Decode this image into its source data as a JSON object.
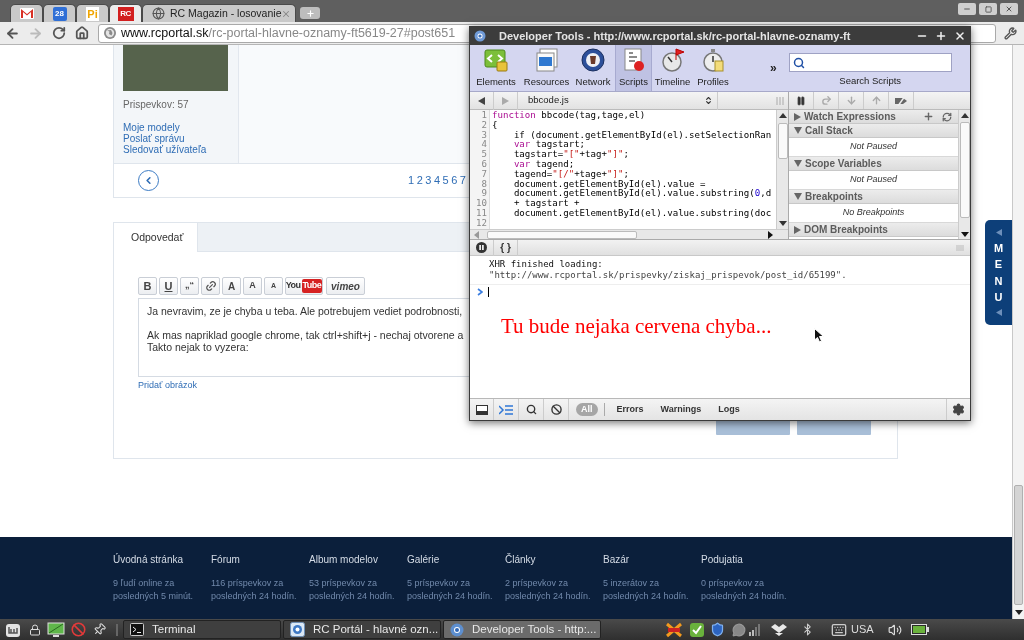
{
  "browser": {
    "tabs": [
      {
        "kind": "mail",
        "selected": false
      },
      {
        "kind": "calendar",
        "icon_text": "28",
        "selected": false
      },
      {
        "kind": "letters",
        "icon_text": "Pi",
        "selected": false
      },
      {
        "kind": "site",
        "icon_text": "RC",
        "selected": true
      },
      {
        "kind": "page",
        "title": "RC Magazin - losovanie",
        "selected": false
      }
    ],
    "url_host": "www.rcportal.sk",
    "url_path": "/rc-portal-hlavne-oznamy-ft5619-27#post651"
  },
  "post": {
    "posts_count": "Prispevkov: 57",
    "links": [
      "Moje modely",
      "Poslať správu",
      "Sledovať užívateľa"
    ],
    "pages": [
      "1",
      "2",
      "3",
      "4",
      "5",
      "6",
      "7"
    ]
  },
  "reply": {
    "tabs": [
      {
        "label": "Odpovedať",
        "selected": true
      }
    ],
    "toolbar": [
      {
        "kind": "bold",
        "label": "B"
      },
      {
        "kind": "underline",
        "label": "U"
      },
      {
        "kind": "quote",
        "label": "„“"
      },
      {
        "kind": "link"
      },
      {
        "kind": "size_large",
        "label": "A"
      },
      {
        "kind": "size_medium",
        "label": "A"
      },
      {
        "kind": "size_small",
        "label": "A"
      },
      {
        "kind": "youtube",
        "label": "You",
        "badge": "Tube"
      },
      {
        "kind": "vimeo",
        "label": "vimeo"
      }
    ],
    "paragraphs": [
      [
        "Ja nevravim, ze je chyba u teba. Ale potrebujem vediet podrobnosti,"
      ],
      [
        "Ak mas napriklad google chrome, tak ctrl+shift+j - nechaj otvorene a",
        "Takto nejak to vyzera:"
      ]
    ],
    "add_image": "Pridať obrázok"
  },
  "menu_tab": {
    "label": "MENU"
  },
  "devtools": {
    "title": "Developer Tools - http://www.rcportal.sk/rc-portal-hlavne-oznamy-ft",
    "tools": [
      {
        "kind": "elements",
        "label": "Elements",
        "selected": false
      },
      {
        "kind": "resources",
        "label": "Resources",
        "selected": false
      },
      {
        "kind": "network",
        "label": "Network",
        "selected": false
      },
      {
        "kind": "scripts",
        "label": "Scripts",
        "selected": true
      },
      {
        "kind": "timeline",
        "label": "Timeline",
        "selected": false
      },
      {
        "kind": "profiles",
        "label": "Profiles",
        "selected": false
      }
    ],
    "more": "»",
    "search_label": "Search Scripts",
    "file": "bbcode.js",
    "code": [
      {
        "n": "1",
        "indented": false,
        "tokens": [
          {
            "kind": "keyword",
            "text": "function"
          },
          {
            "kind": "plain",
            "text": " bbcode(tag,tage,el)"
          }
        ]
      },
      {
        "n": "2",
        "indented": false,
        "tokens": [
          {
            "kind": "plain",
            "text": "{"
          }
        ]
      },
      {
        "n": "3",
        "indented": true,
        "tokens": [
          {
            "kind": "plain",
            "text": "if (document.getElementById(el).setSelectionRan"
          }
        ]
      },
      {
        "n": "4",
        "indented": true,
        "tokens": [
          {
            "kind": "keyword",
            "text": "var"
          },
          {
            "kind": "plain",
            "text": " tagstart;"
          }
        ]
      },
      {
        "n": "5",
        "indented": true,
        "tokens": [
          {
            "kind": "plain",
            "text": "tagstart="
          },
          {
            "kind": "string",
            "text": "\"[\""
          },
          {
            "kind": "plain",
            "text": "+tag+"
          },
          {
            "kind": "string",
            "text": "\"]\""
          },
          {
            "kind": "plain",
            "text": ";"
          }
        ]
      },
      {
        "n": "6",
        "indented": true,
        "tokens": [
          {
            "kind": "keyword",
            "text": "var"
          },
          {
            "kind": "plain",
            "text": " tagend;"
          }
        ]
      },
      {
        "n": "7",
        "indented": true,
        "tokens": [
          {
            "kind": "plain",
            "text": "tagend="
          },
          {
            "kind": "string",
            "text": "\"[/\""
          },
          {
            "kind": "plain",
            "text": "+tage+"
          },
          {
            "kind": "string",
            "text": "\"]\""
          },
          {
            "kind": "plain",
            "text": ";"
          }
        ]
      },
      {
        "n": "8",
        "indented": true,
        "tokens": [
          {
            "kind": "plain",
            "text": "document.getElementById(el).value ="
          }
        ]
      },
      {
        "n": "9",
        "indented": true,
        "tokens": [
          {
            "kind": "plain",
            "text": "document.getElementById(el).value.substring("
          },
          {
            "kind": "number",
            "text": "0"
          },
          {
            "kind": "plain",
            "text": ",d"
          }
        ]
      },
      {
        "n": "10",
        "indented": true,
        "tokens": [
          {
            "kind": "plain",
            "text": "+ tagstart +"
          }
        ]
      },
      {
        "n": "11",
        "indented": true,
        "tokens": [
          {
            "kind": "plain",
            "text": "document.getElementById(el).value.substring(doc"
          }
        ]
      },
      {
        "n": "12"
      }
    ],
    "sidebar": [
      {
        "kind": "watch",
        "title": "Watch Expressions",
        "expanded": false
      },
      {
        "kind": "section",
        "title": "Call Stack",
        "expanded": true,
        "content": "Not Paused"
      },
      {
        "kind": "section",
        "title": "Scope Variables",
        "expanded": true,
        "content": "Not Paused"
      },
      {
        "kind": "section",
        "title": "Breakpoints",
        "expanded": true,
        "content": "No Breakpoints"
      },
      {
        "kind": "section",
        "title": "DOM Breakpoints",
        "expanded": false
      }
    ],
    "console": {
      "pretty_print": "{ }",
      "messages": [
        {
          "kind": "text",
          "text": "XHR finished loading:"
        },
        {
          "kind": "url",
          "text": "\"http://www.rcportal.sk/prispevky/ziskaj_prispevok/post_id/65199\"."
        }
      ],
      "annotation": "Tu bude nejaka cervena chyba..."
    },
    "filters": [
      {
        "label": "All",
        "selected": true
      },
      {
        "label": "Errors",
        "selected": false
      },
      {
        "label": "Warnings",
        "selected": false
      },
      {
        "label": "Logs",
        "selected": false
      }
    ]
  },
  "footer": {
    "columns": [
      {
        "title": "Úvodná stránka",
        "stats": "9 ľudí online za posledných 5 minút."
      },
      {
        "title": "Fórum",
        "stats": "116 príspevkov za posledných 24 hodín."
      },
      {
        "title": "Album modelov",
        "stats": "53 príspevkov za posledných 24 hodín."
      },
      {
        "title": "Galérie",
        "stats": "5 príspevkov za posledných 24 hodín."
      },
      {
        "title": "Články",
        "stats": "2 príspevkov za posledných 24 hodín."
      },
      {
        "title": "Bazár",
        "stats": "5 inzerátov za posledných 24 hodín."
      },
      {
        "title": "Podujatia",
        "stats": "0 príspevkov za posledných 24 hodín."
      }
    ]
  },
  "taskbar": {
    "tasks": [
      {
        "kind": "terminal",
        "label": "Terminal",
        "selected": false
      },
      {
        "kind": "browser",
        "label": "RC Portál - hlavné ozn...",
        "selected": false
      },
      {
        "kind": "devtools",
        "label": "Developer Tools - http:...",
        "selected": true
      }
    ],
    "keyboard_layout": "USA"
  }
}
